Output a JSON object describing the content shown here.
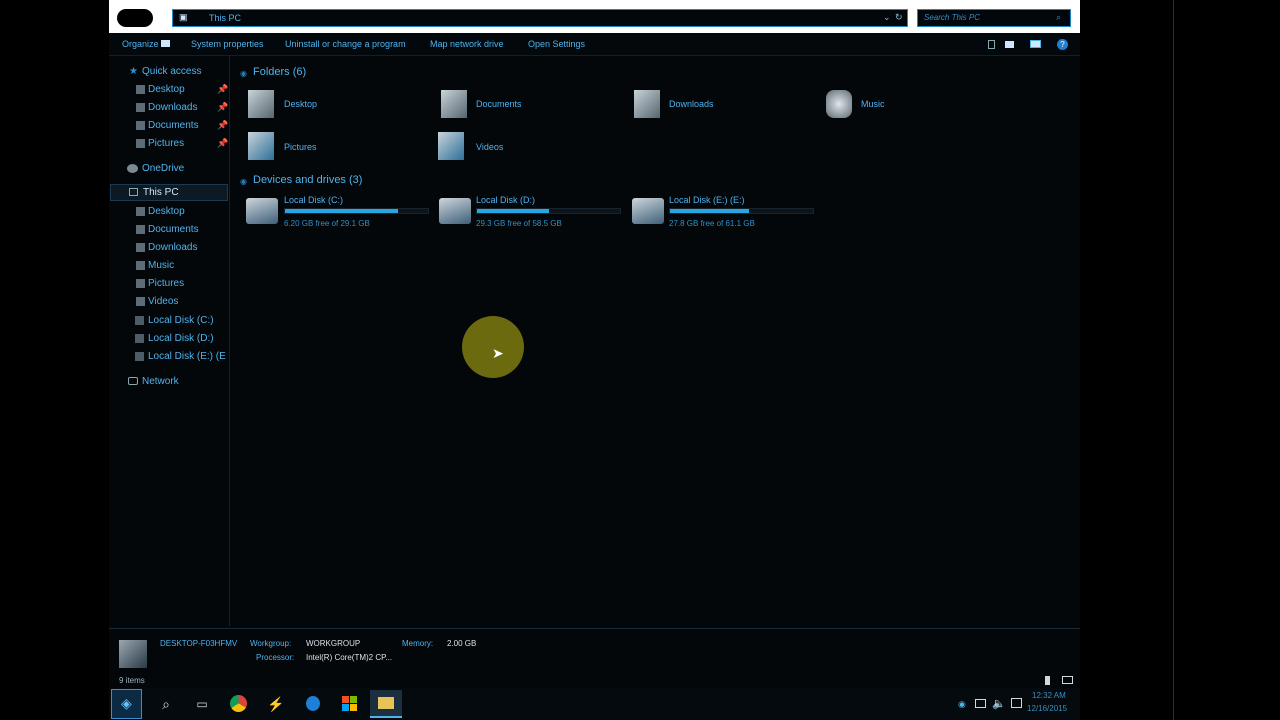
{
  "window": {
    "address": "This PC",
    "search_placeholder": "Search This PC"
  },
  "command_bar": {
    "organize": "Organize",
    "system_properties": "System properties",
    "uninstall": "Uninstall or change a program",
    "map_drive": "Map network drive",
    "open_settings": "Open Settings"
  },
  "nav": {
    "quick_access": "Quick access",
    "qa_items": [
      "Desktop",
      "Downloads",
      "Documents",
      "Pictures"
    ],
    "onedrive": "OneDrive",
    "this_pc": "This PC",
    "pc_items": [
      "Desktop",
      "Documents",
      "Downloads",
      "Music",
      "Pictures",
      "Videos",
      "Local Disk (C:)",
      "Local Disk (D:)",
      "Local Disk (E:) (E"
    ],
    "network": "Network"
  },
  "folders": {
    "header": "Folders (6)",
    "items": [
      "Desktop",
      "Documents",
      "Downloads",
      "Music",
      "Pictures",
      "Videos"
    ]
  },
  "drives": {
    "header": "Devices and drives (3)",
    "items": [
      {
        "name": "Local Disk (C:)",
        "free": "6.20 GB free of 29.1 GB",
        "used_fraction": 0.79
      },
      {
        "name": "Local Disk (D:)",
        "free": "29.3 GB free of 58.5 GB",
        "used_fraction": 0.5
      },
      {
        "name": "Local Disk (E:) (E:)",
        "free": "27.8 GB free of 61.1 GB",
        "used_fraction": 0.55
      }
    ]
  },
  "details": {
    "computer_name": "DESKTOP-F03HFMV",
    "workgroup_label": "Workgroup:",
    "workgroup_value": "WORKGROUP",
    "memory_label": "Memory:",
    "memory_value": "2.00 GB",
    "processor_label": "Processor:",
    "processor_value": "Intel(R) Core(TM)2 CP..."
  },
  "status": {
    "item_count": "9 items"
  },
  "taskbar": {
    "time": "12:32 AM",
    "date": "12/16/2015"
  },
  "colors": {
    "accent": "#4fb3ee",
    "window_bg": "#040709",
    "cursor_highlight": "#6b6a0f"
  }
}
